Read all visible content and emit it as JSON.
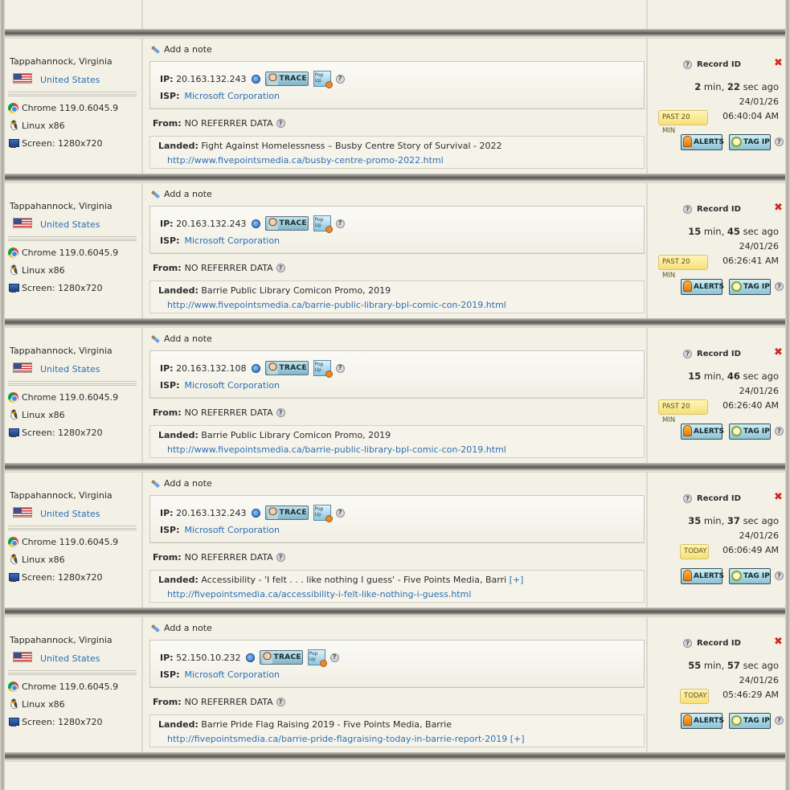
{
  "records": [
    {
      "city": "Tappahannock, Virginia",
      "country": "United States",
      "browser": "Chrome 119.0.6045.9",
      "os": "Linux x86",
      "screen": "Screen: 1280x720",
      "note_label": "Add a note",
      "ip_label": "IP:",
      "ip": "20.163.132.243",
      "trace_label": "TRACE",
      "popup_label": "Pop Up",
      "isp_label": "ISP:",
      "isp": "Microsoft Corporation",
      "from_label": "From:",
      "from": "NO REFERRER DATA",
      "landed_label": "Landed:",
      "landed_title": "Fight Against Homelessness – Busby Centre Story of Survival - 2022",
      "landed_url": "http://www.fivepointsmedia.ca/busby-centre-promo-2022.html",
      "landed_expand": "",
      "record_id_label": "Record ID",
      "ago_min": "2",
      "ago_min_unit": "min,",
      "ago_sec": "22",
      "ago_sec_unit": "sec ago",
      "date": "24/01/26",
      "time": "06:40:04 AM",
      "badge": "PAST 20 MIN",
      "badge_type": "past",
      "alerts_label": "ALERTS",
      "tagip_label": "TAG IP"
    },
    {
      "city": "Tappahannock, Virginia",
      "country": "United States",
      "browser": "Chrome 119.0.6045.9",
      "os": "Linux x86",
      "screen": "Screen: 1280x720",
      "note_label": "Add a note",
      "ip_label": "IP:",
      "ip": "20.163.132.243",
      "trace_label": "TRACE",
      "popup_label": "Pop Up",
      "isp_label": "ISP:",
      "isp": "Microsoft Corporation",
      "from_label": "From:",
      "from": "NO REFERRER DATA",
      "landed_label": "Landed:",
      "landed_title": "Barrie Public Library Comicon Promo, 2019",
      "landed_url": "http://www.fivepointsmedia.ca/barrie-public-library-bpl-comic-con-2019.html",
      "landed_expand": "",
      "record_id_label": "Record ID",
      "ago_min": "15",
      "ago_min_unit": "min,",
      "ago_sec": "45",
      "ago_sec_unit": "sec ago",
      "date": "24/01/26",
      "time": "06:26:41 AM",
      "badge": "PAST 20 MIN",
      "badge_type": "past",
      "alerts_label": "ALERTS",
      "tagip_label": "TAG IP"
    },
    {
      "city": "Tappahannock, Virginia",
      "country": "United States",
      "browser": "Chrome 119.0.6045.9",
      "os": "Linux x86",
      "screen": "Screen: 1280x720",
      "note_label": "Add a note",
      "ip_label": "IP:",
      "ip": "20.163.132.108",
      "trace_label": "TRACE",
      "popup_label": "Pop Up",
      "isp_label": "ISP:",
      "isp": "Microsoft Corporation",
      "from_label": "From:",
      "from": "NO REFERRER DATA",
      "landed_label": "Landed:",
      "landed_title": "Barrie Public Library Comicon Promo, 2019",
      "landed_url": "http://www.fivepointsmedia.ca/barrie-public-library-bpl-comic-con-2019.html",
      "landed_expand": "",
      "record_id_label": "Record ID",
      "ago_min": "15",
      "ago_min_unit": "min,",
      "ago_sec": "46",
      "ago_sec_unit": "sec ago",
      "date": "24/01/26",
      "time": "06:26:40 AM",
      "badge": "PAST 20 MIN",
      "badge_type": "past",
      "alerts_label": "ALERTS",
      "tagip_label": "TAG IP"
    },
    {
      "city": "Tappahannock, Virginia",
      "country": "United States",
      "browser": "Chrome 119.0.6045.9",
      "os": "Linux x86",
      "screen": "Screen: 1280x720",
      "note_label": "Add a note",
      "ip_label": "IP:",
      "ip": "20.163.132.243",
      "trace_label": "TRACE",
      "popup_label": "Pop Up",
      "isp_label": "ISP:",
      "isp": "Microsoft Corporation",
      "from_label": "From:",
      "from": "NO REFERRER DATA",
      "landed_label": "Landed:",
      "landed_title": "Accessibility - 'I felt . . . like nothing I guess' - Five Points Media, Barri",
      "landed_url": "http://fivepointsmedia.ca/accessibility-i-felt-like-nothing-i-guess.html",
      "landed_expand": "[+]",
      "landed_expand_place": "title",
      "record_id_label": "Record ID",
      "ago_min": "35",
      "ago_min_unit": "min,",
      "ago_sec": "37",
      "ago_sec_unit": "sec ago",
      "date": "24/01/26",
      "time": "06:06:49 AM",
      "badge": "TODAY",
      "badge_type": "today",
      "alerts_label": "ALERTS",
      "tagip_label": "TAG IP"
    },
    {
      "city": "Tappahannock, Virginia",
      "country": "United States",
      "browser": "Chrome 119.0.6045.9",
      "os": "Linux x86",
      "screen": "Screen: 1280x720",
      "note_label": "Add a note",
      "ip_label": "IP:",
      "ip": "52.150.10.232",
      "trace_label": "TRACE",
      "popup_label": "Pop Up",
      "isp_label": "ISP:",
      "isp": "Microsoft Corporation",
      "from_label": "From:",
      "from": "NO REFERRER DATA",
      "landed_label": "Landed:",
      "landed_title": "Barrie Pride Flag Raising 2019 - Five Points Media, Barrie",
      "landed_url": "http://fivepointsmedia.ca/barrie-pride-flagraising-today-in-barrie-report-2019",
      "landed_expand": "[+]",
      "landed_expand_place": "url",
      "record_id_label": "Record ID",
      "ago_min": "55",
      "ago_min_unit": "min,",
      "ago_sec": "57",
      "ago_sec_unit": "sec ago",
      "date": "24/01/26",
      "time": "05:46:29 AM",
      "badge": "TODAY",
      "badge_type": "today",
      "alerts_label": "ALERTS",
      "tagip_label": "TAG IP"
    }
  ],
  "icons": {
    "browser": "chrome-icon",
    "os": "linux-penguin-icon",
    "screen": "monitor-icon",
    "note": "pencil-icon",
    "lookup": "ip-lookup-icon",
    "help": "help-icon",
    "delete": "delete-x-icon",
    "alerts": "bell-icon",
    "tagip": "tag-icon"
  },
  "colors": {
    "background": "#f3f1e6",
    "link": "#2a6fb5",
    "delete": "#d8231a",
    "badge": "#f7df78"
  }
}
